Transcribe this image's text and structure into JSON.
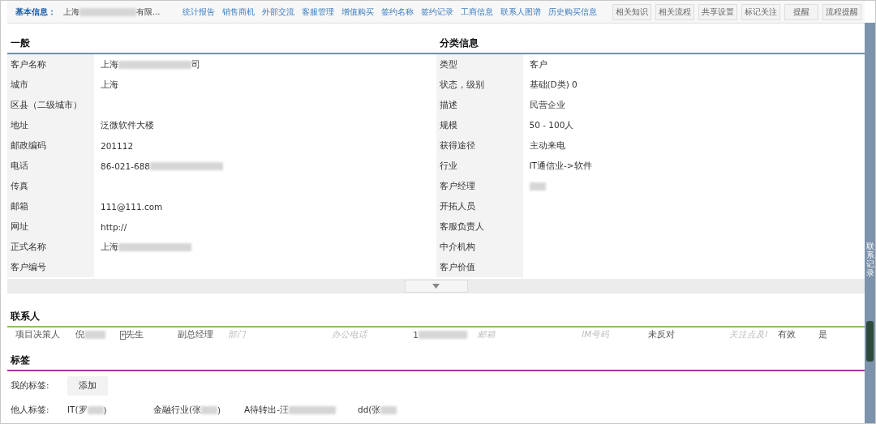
{
  "header": {
    "label": "基本信息：",
    "value": [
      {
        "kind": "text",
        "text": "上海"
      },
      {
        "kind": "redacted"
      },
      {
        "kind": "text",
        "text": "有限..."
      }
    ],
    "links": [
      "统计报告",
      "销售商机",
      "外部交流",
      "客服管理",
      "增值购买",
      "签约名称",
      "签约记录",
      "工商信息",
      "联系人图谱",
      "历史购买信息"
    ],
    "buttons": [
      "相关知识",
      "相关流程",
      "共享设置",
      "标记关注",
      "提醒",
      "流程提醒"
    ]
  },
  "general": {
    "title": "一般",
    "rows": [
      {
        "label": "客户名称",
        "value": [
          {
            "kind": "text",
            "text": "上海"
          },
          {
            "kind": "redacted"
          },
          {
            "kind": "text",
            "text": "司"
          }
        ]
      },
      {
        "label": "城市",
        "value": [
          {
            "kind": "text",
            "text": "上海"
          }
        ]
      },
      {
        "label": "区县（二级城市）",
        "value": []
      },
      {
        "label": "地址",
        "value": [
          {
            "kind": "text",
            "text": "泛微软件大楼"
          }
        ]
      },
      {
        "label": "邮政编码",
        "value": [
          {
            "kind": "text",
            "text": "201112"
          }
        ]
      },
      {
        "label": "电话",
        "value": [
          {
            "kind": "text",
            "text": "86-021-688"
          },
          {
            "kind": "redacted"
          }
        ]
      },
      {
        "label": "传真",
        "value": []
      },
      {
        "label": "邮箱",
        "value": [
          {
            "kind": "text",
            "text": "111@111.com"
          }
        ]
      },
      {
        "label": "网址",
        "value": [
          {
            "kind": "text",
            "text": "http://"
          }
        ]
      },
      {
        "label": "正式名称",
        "value": [
          {
            "kind": "text",
            "text": "上海"
          },
          {
            "kind": "redacted"
          }
        ]
      },
      {
        "label": "客户编号",
        "value": []
      }
    ]
  },
  "category": {
    "title": "分类信息",
    "rows": [
      {
        "label": "类型",
        "value": [
          {
            "kind": "text",
            "text": "客户"
          }
        ]
      },
      {
        "label": "状态，级别",
        "value": [
          {
            "kind": "text",
            "text": "基础(D类)  0"
          }
        ]
      },
      {
        "label": "描述",
        "value": [
          {
            "kind": "text",
            "text": "民营企业"
          }
        ]
      },
      {
        "label": "规模",
        "value": [
          {
            "kind": "text",
            "text": "50 - 100人"
          }
        ]
      },
      {
        "label": "获得途径",
        "value": [
          {
            "kind": "text",
            "text": "主动来电"
          }
        ]
      },
      {
        "label": "行业",
        "value": [
          {
            "kind": "text",
            "text": "IT通信业->软件"
          }
        ]
      },
      {
        "label": "客户经理",
        "value": [
          {
            "kind": "redacted"
          }
        ]
      },
      {
        "label": "开拓人员",
        "value": []
      },
      {
        "label": "客服负责人",
        "value": []
      },
      {
        "label": "中介机构",
        "value": []
      },
      {
        "label": "客户价值",
        "value": []
      }
    ]
  },
  "contacts": {
    "title": "联系人",
    "rows": [
      {
        "role": "项目决策人",
        "name": [
          {
            "kind": "text",
            "text": "倪"
          },
          {
            "kind": "redacted"
          }
        ],
        "add": "+",
        "title": "先生",
        "position": "副总经理",
        "cells": [
          {
            "kind": "placeholder",
            "text": "部门"
          },
          {
            "kind": "placeholder",
            "text": "办公电话"
          },
          {
            "kind": "value",
            "parts": [
              {
                "kind": "text",
                "text": "1"
              },
              {
                "kind": "redacted"
              }
            ]
          },
          {
            "kind": "placeholder",
            "text": "邮箱"
          },
          {
            "kind": "placeholder",
            "text": "IM号码"
          },
          {
            "kind": "value",
            "parts": [
              {
                "kind": "text",
                "text": "未反对"
              }
            ]
          },
          {
            "kind": "placeholder",
            "text": "关注点及l"
          },
          {
            "kind": "value",
            "parts": [
              {
                "kind": "text",
                "text": "有效"
              }
            ]
          },
          {
            "kind": "value",
            "parts": [
              {
                "kind": "text",
                "text": "是"
              }
            ]
          }
        ]
      }
    ]
  },
  "tags": {
    "title": "标签",
    "mine_label": "我的标签:",
    "add_button": "添加",
    "others_label": "他人标签:",
    "others": [
      [
        {
          "kind": "text",
          "text": "IT(罗"
        },
        {
          "kind": "redacted"
        },
        {
          "kind": "text",
          "text": ")"
        }
      ],
      [
        {
          "kind": "text",
          "text": "金融行业(张"
        },
        {
          "kind": "redacted"
        },
        {
          "kind": "text",
          "text": ")"
        }
      ],
      [
        {
          "kind": "text",
          "text": "A待转出-汪"
        },
        {
          "kind": "redacted"
        }
      ],
      [
        {
          "kind": "text",
          "text": "dd(张"
        },
        {
          "kind": "redacted"
        }
      ]
    ]
  },
  "side_tab": "联系记录"
}
